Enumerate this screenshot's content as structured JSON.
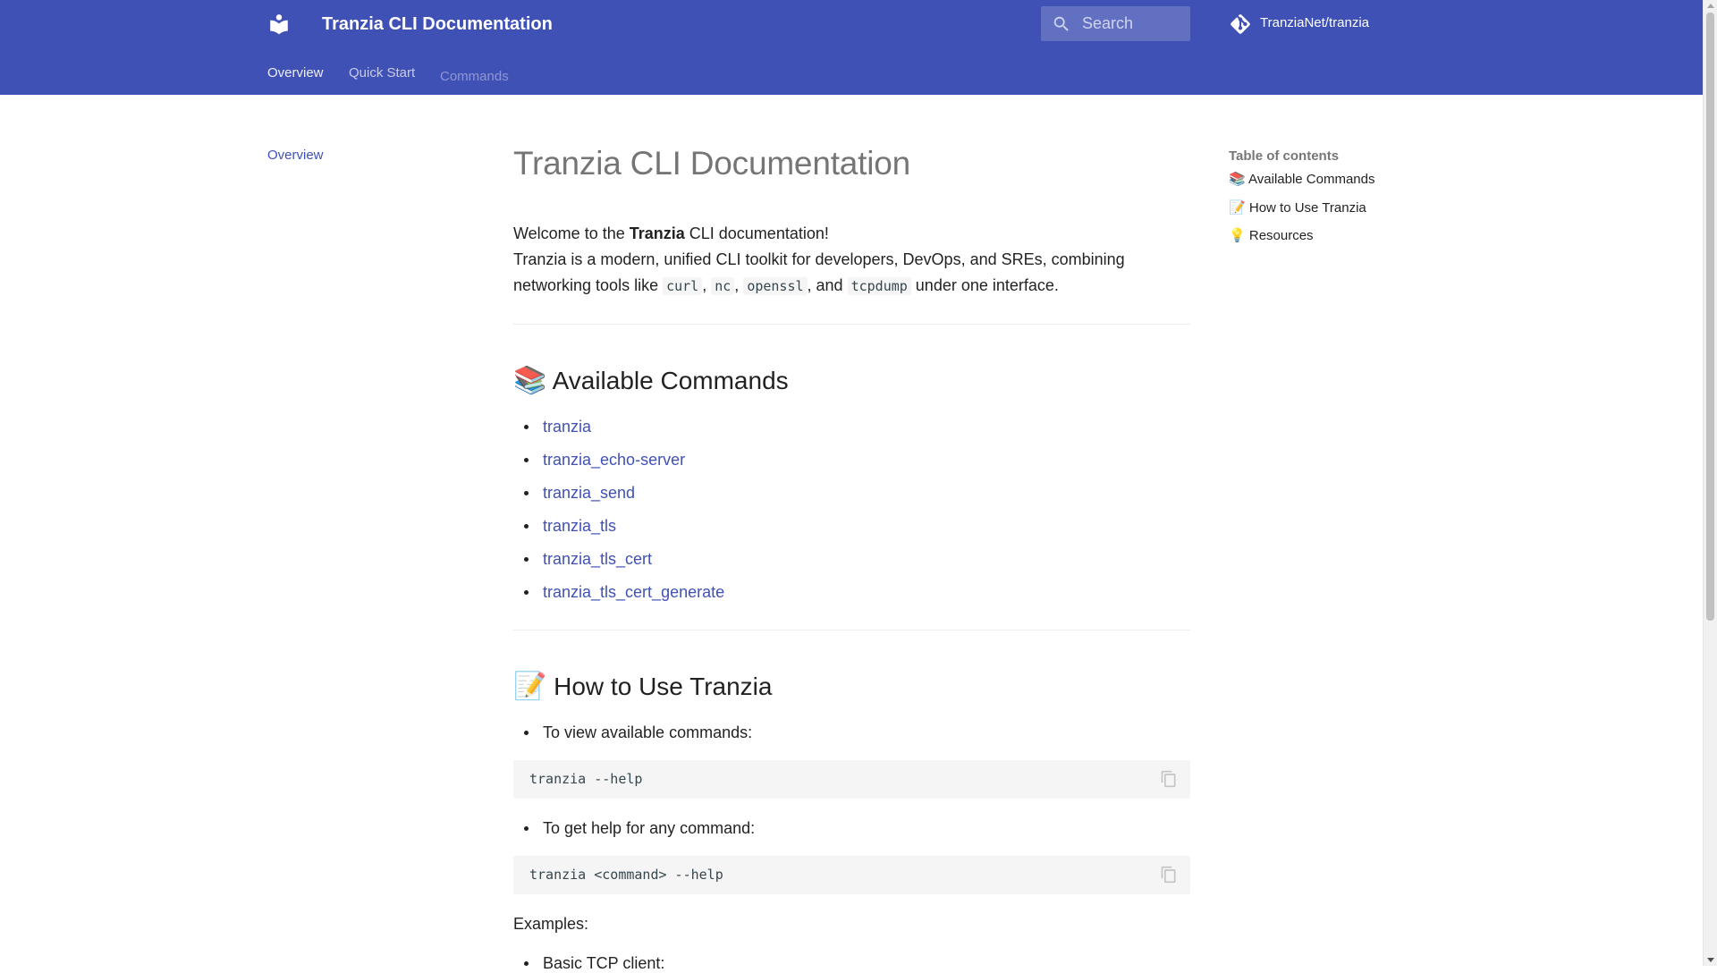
{
  "header": {
    "site_title": "Tranzia CLI Documentation",
    "logo_icon": "book-reader-icon",
    "search": {
      "placeholder": "Search",
      "icon": "magnify-icon"
    },
    "repo": {
      "label": "TranziaNet/tranzia",
      "icon": "git-icon"
    },
    "tabs": [
      {
        "label": "Overview",
        "active": true
      },
      {
        "label": "Quick Start",
        "active": false
      },
      {
        "label": "Commands",
        "active": false
      }
    ],
    "accent_color": "#4051b5"
  },
  "nav": {
    "items": [
      {
        "label": "Overview"
      }
    ]
  },
  "main": {
    "title": "Tranzia CLI Documentation",
    "intro": {
      "welcome_prefix": "Welcome to the ",
      "welcome_bold": "Tranzia",
      "welcome_suffix": " CLI documentation!",
      "line2": "Tranzia is a modern, unified CLI toolkit for developers, DevOps, and SREs, combining",
      "line3_prefix": "networking tools like ",
      "code1": "curl",
      "sep1": ", ",
      "code2": "nc",
      "sep2": ", ",
      "code3": "openssl",
      "sep3": ", and ",
      "code4": "tcpdump",
      "line3_suffix": " under one interface."
    },
    "commands_section": {
      "emoji": "📚",
      "heading": "Available Commands",
      "links": [
        "tranzia",
        "tranzia_echo-server",
        "tranzia_send",
        "tranzia_tls",
        "tranzia_tls_cert",
        "tranzia_tls_cert_generate"
      ]
    },
    "usage_section": {
      "emoji": "📝",
      "heading": "How to Use Tranzia",
      "bullet1": "To view available commands:",
      "code1": "tranzia --help",
      "bullet2": "To get help for any command:",
      "code2": "tranzia <command> --help",
      "examples_label": "Examples:",
      "bullet3": "Basic TCP client:"
    }
  },
  "toc": {
    "title": "Table of contents",
    "items": [
      {
        "emoji": "📚",
        "label": "Available Commands"
      },
      {
        "emoji": "📝",
        "label": "How to Use Tranzia"
      },
      {
        "emoji": "💡",
        "label": "Resources"
      }
    ]
  }
}
